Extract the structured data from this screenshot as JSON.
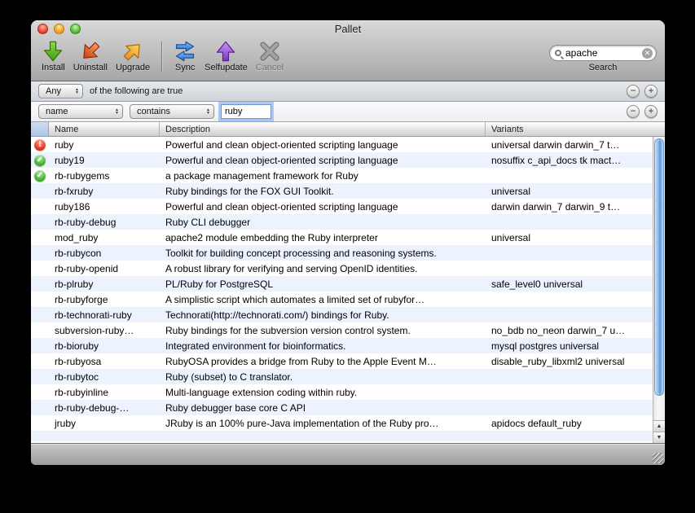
{
  "window": {
    "title": "Pallet"
  },
  "colors": {
    "status_error": "#c51a06",
    "status_ok": "#2a9c1d",
    "accent_scrollbar_blue": "#7fb0ea",
    "row_stripe_blue": "#edf3fe"
  },
  "toolbar": {
    "buttons": [
      {
        "label": "Install",
        "icon": "green-down-arrow-icon",
        "disabled": false
      },
      {
        "label": "Uninstall",
        "icon": "red-downleft-arrow-icon",
        "disabled": false
      },
      {
        "label": "Upgrade",
        "icon": "orange-upright-arrow-icon",
        "disabled": false
      },
      {
        "label": "Sync",
        "icon": "blue-sync-arrows-icon",
        "disabled": false
      },
      {
        "label": "Selfupdate",
        "icon": "purple-up-arrow-icon",
        "disabled": false
      },
      {
        "label": "Cancel",
        "icon": "gray-x-icon",
        "disabled": true
      }
    ],
    "search": {
      "value": "apache",
      "label": "Search"
    }
  },
  "filter": {
    "match_popup": "Any",
    "condition_text": "of the following are true",
    "rule_field": "name",
    "rule_operator": "contains",
    "rule_value": "ruby"
  },
  "table": {
    "columns": [
      "Name",
      "Description",
      "Variants"
    ],
    "rows": [
      {
        "status": "error",
        "name": "ruby",
        "description": "Powerful and clean object-oriented scripting language",
        "variants": "universal darwin darwin_7 t…"
      },
      {
        "status": "ok",
        "name": "ruby19",
        "description": "Powerful and clean object-oriented scripting language",
        "variants": "nosuffix c_api_docs tk mact…"
      },
      {
        "status": "ok",
        "name": "rb-rubygems",
        "description": "a package management framework for Ruby",
        "variants": ""
      },
      {
        "status": "",
        "name": "rb-fxruby",
        "description": "Ruby bindings for the FOX GUI Toolkit.",
        "variants": "universal"
      },
      {
        "status": "",
        "name": "ruby186",
        "description": "Powerful and clean object-oriented scripting language",
        "variants": "darwin darwin_7 darwin_9 t…"
      },
      {
        "status": "",
        "name": "rb-ruby-debug",
        "description": "Ruby CLI debugger",
        "variants": ""
      },
      {
        "status": "",
        "name": "mod_ruby",
        "description": "apache2 module embedding the Ruby interpreter",
        "variants": "universal"
      },
      {
        "status": "",
        "name": "rb-rubycon",
        "description": "Toolkit for building concept processing and reasoning systems.",
        "variants": ""
      },
      {
        "status": "",
        "name": "rb-ruby-openid",
        "description": "A robust library for verifying and serving OpenID identities.",
        "variants": ""
      },
      {
        "status": "",
        "name": "rb-plruby",
        "description": "PL/Ruby for PostgreSQL",
        "variants": "safe_level0 universal"
      },
      {
        "status": "",
        "name": "rb-rubyforge",
        "description": "A simplistic script which automates a limited set of rubyfor…",
        "variants": ""
      },
      {
        "status": "",
        "name": "rb-technorati-ruby",
        "description": "Technorati(http://technorati.com/) bindings for Ruby.",
        "variants": ""
      },
      {
        "status": "",
        "name": "subversion-ruby…",
        "description": "Ruby bindings for the subversion version control system.",
        "variants": "no_bdb no_neon darwin_7 u…"
      },
      {
        "status": "",
        "name": "rb-bioruby",
        "description": "Integrated environment for bioinformatics.",
        "variants": "mysql postgres universal"
      },
      {
        "status": "",
        "name": "rb-rubyosa",
        "description": "RubyOSA provides a bridge from Ruby to the Apple Event M…",
        "variants": "disable_ruby_libxml2 universal"
      },
      {
        "status": "",
        "name": "rb-rubytoc",
        "description": "Ruby (subset) to C translator.",
        "variants": ""
      },
      {
        "status": "",
        "name": "rb-rubyinline",
        "description": "Multi-language extension coding within ruby.",
        "variants": ""
      },
      {
        "status": "",
        "name": "rb-ruby-debug-…",
        "description": "Ruby debugger base core C API",
        "variants": ""
      },
      {
        "status": "",
        "name": "jruby",
        "description": "JRuby is an 100% pure-Java implementation of the Ruby pro…",
        "variants": "apidocs default_ruby"
      }
    ]
  }
}
